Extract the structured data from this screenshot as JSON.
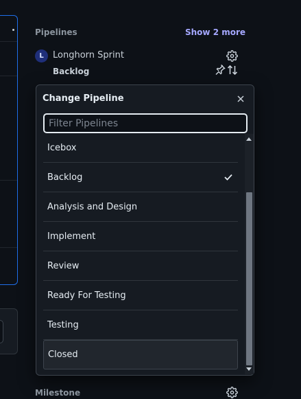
{
  "sidebar": {
    "pipelines_title": "Pipelines",
    "show_more": "Show 2 more",
    "repo": {
      "avatar_letter": "L",
      "name": "Longhorn Sprint",
      "pipeline": "Backlog"
    },
    "milestone_title": "Milestone",
    "icons": {
      "settings": "gear-icon",
      "pin": "pin-icon",
      "move": "sort-arrows-icon"
    }
  },
  "dropdown": {
    "title": "Change Pipeline",
    "close_icon": "close-icon",
    "filter": {
      "placeholder": "Filter Pipelines",
      "value": ""
    },
    "items": [
      {
        "label": "Icebox",
        "selected": false
      },
      {
        "label": "Backlog",
        "selected": true
      },
      {
        "label": "Analysis and Design",
        "selected": false
      },
      {
        "label": "Implement",
        "selected": false
      },
      {
        "label": "Review",
        "selected": false
      },
      {
        "label": "Ready For Testing",
        "selected": false
      },
      {
        "label": "Testing",
        "selected": false
      },
      {
        "label": "Closed",
        "selected": false
      }
    ],
    "highlighted": "Closed"
  },
  "colors": {
    "background": "#0d1117",
    "panel": "#161b22",
    "accent_link": "#a5a8ff",
    "focus_border": "#1f6feb"
  }
}
